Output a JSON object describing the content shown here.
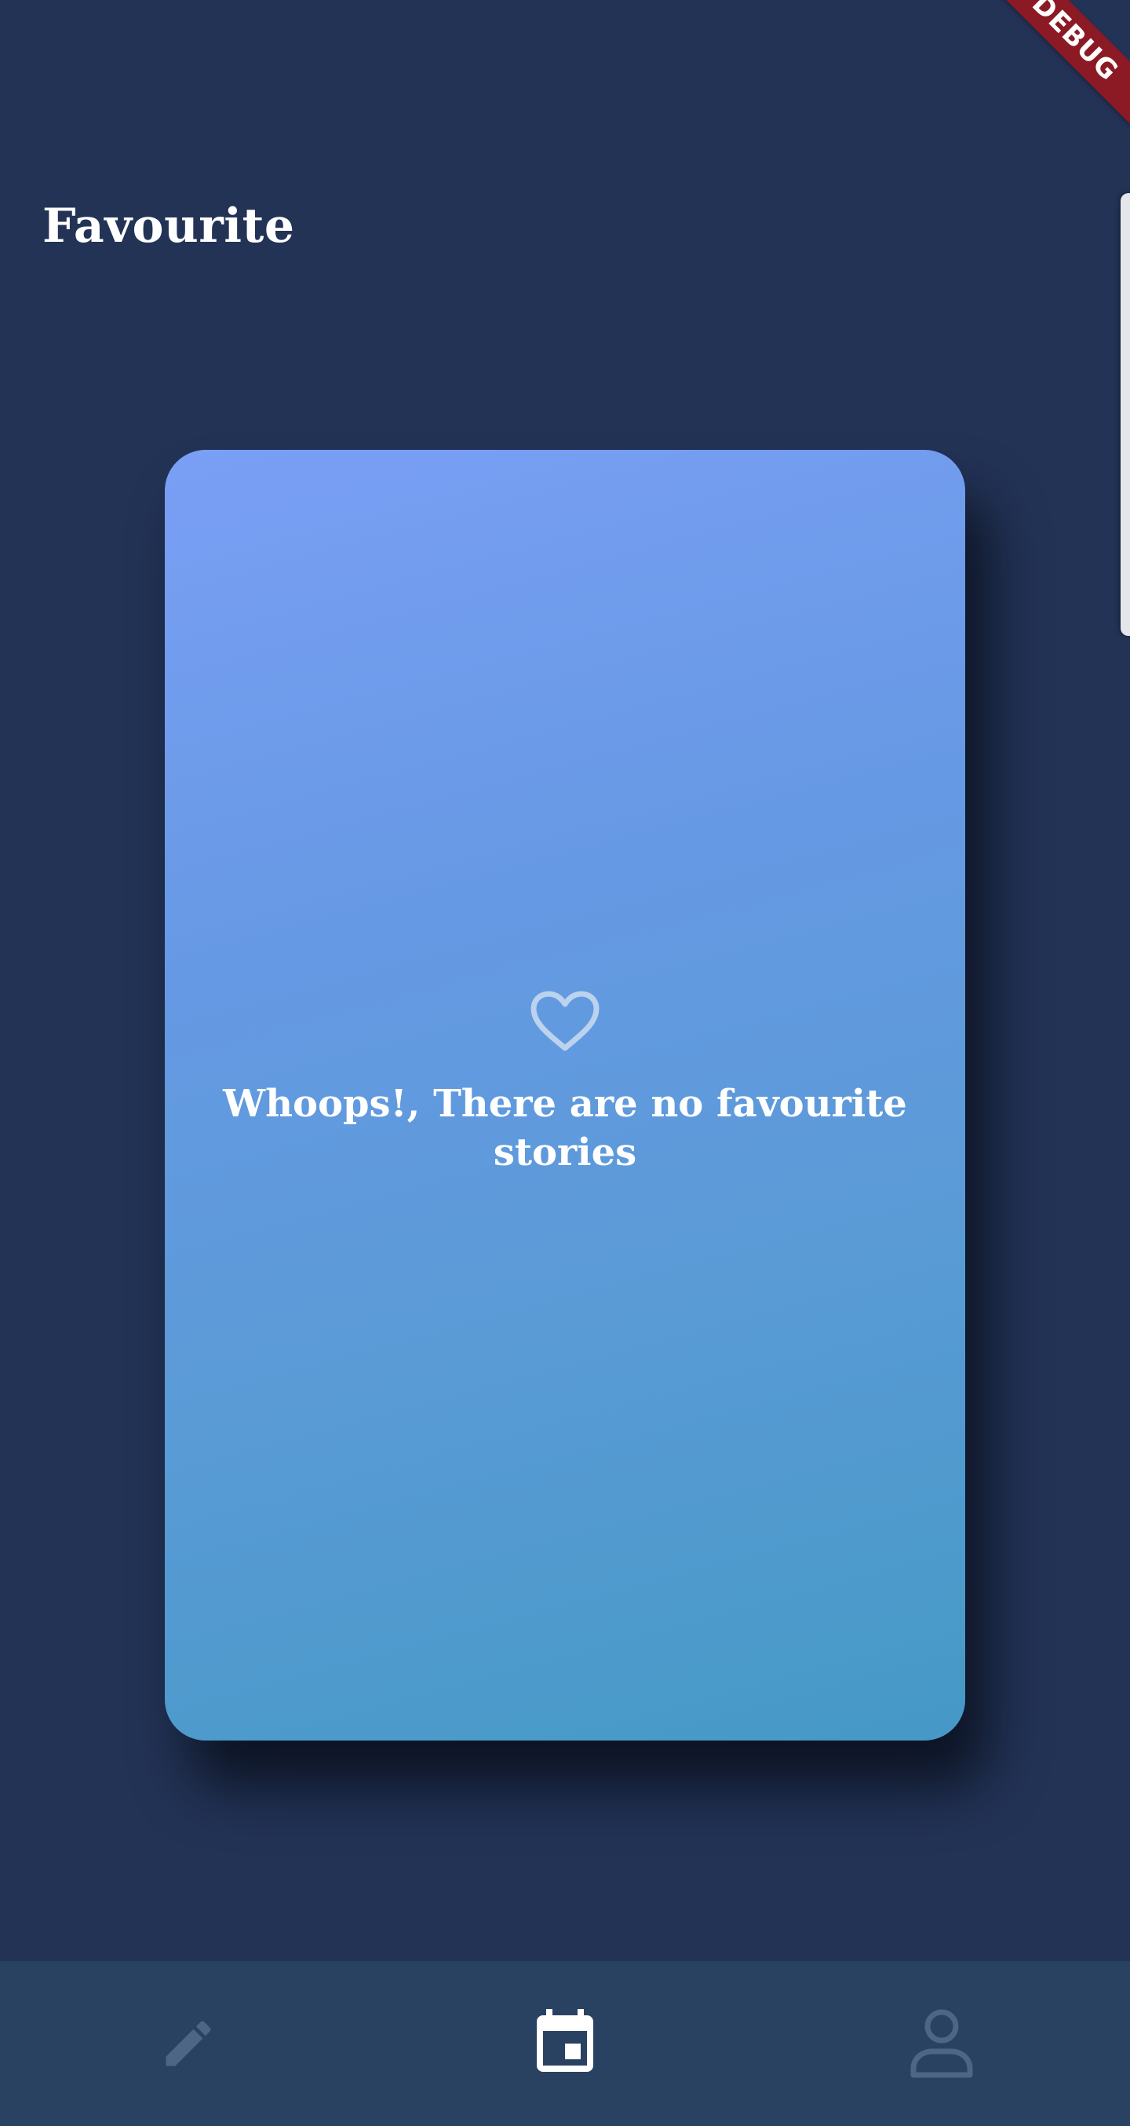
{
  "header": {
    "title": "Favourite"
  },
  "debug_banner": {
    "label": "DEBUG"
  },
  "empty_state": {
    "icon": "heart-outline-icon",
    "message": "Whoops!, There are no favourite stories"
  },
  "bottom_nav": {
    "items": [
      {
        "icon": "pencil-icon",
        "active": false
      },
      {
        "icon": "calendar-icon",
        "active": true
      },
      {
        "icon": "person-icon",
        "active": false
      }
    ]
  },
  "colors": {
    "background": "#233356",
    "card_gradient_start": "#7a9ff5",
    "card_gradient_end": "#4599c6",
    "nav_background": "#2a4262",
    "nav_active": "#ffffff",
    "nav_inactive": "#4e6685",
    "debug_banner": "#8b1a24"
  }
}
